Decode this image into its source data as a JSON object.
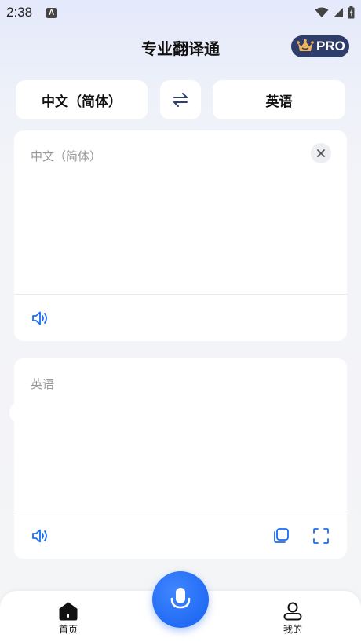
{
  "status_bar": {
    "time": "2:38",
    "notification_letter": "A"
  },
  "header": {
    "title": "专业翻译通",
    "pro_badge": "PRO",
    "pro_icon": "crown-icon"
  },
  "language_bar": {
    "source_language": "中文（简体）",
    "target_language": "英语",
    "swap_icon": "swap-icon"
  },
  "source_card": {
    "placeholder": "中文（简体）",
    "clear_icon": "close-icon",
    "speaker_icon": "speaker-icon"
  },
  "target_card": {
    "placeholder": "英语",
    "speaker_icon": "speaker-icon",
    "copy_icon": "copy-icon",
    "fullscreen_icon": "fullscreen-icon"
  },
  "bottom_nav": {
    "items": [
      {
        "label": "首页",
        "icon": "home-icon",
        "active": true
      },
      {
        "label": "我的",
        "icon": "user-icon",
        "active": false
      }
    ],
    "center_button_icon": "microphone-icon"
  },
  "colors": {
    "accent": "#1a6cf5",
    "pro_badge_bg": "#2e3d6a",
    "crown": "#f0b25a"
  }
}
